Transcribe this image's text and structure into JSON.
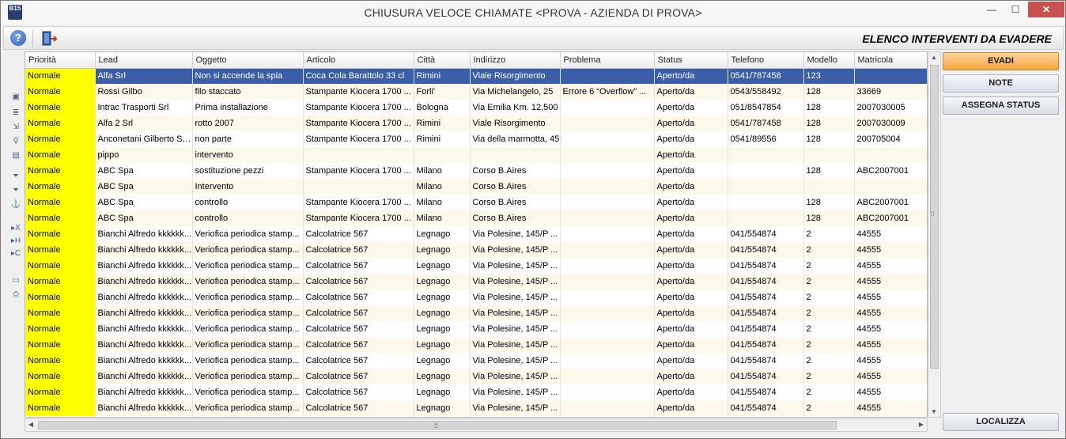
{
  "window": {
    "app_logo": "B15",
    "title": "CHIUSURA VELOCE CHIAMATE <PROVA - AZIENDA DI PROVA>",
    "minimize": "—",
    "maximize": "☐",
    "close": "✕"
  },
  "toolbar": {
    "help": "?",
    "title": "ELENCO INTERVENTI DA EVADERE"
  },
  "sidebar_icons": [
    "form-icon",
    "list-icon",
    "export-icon",
    "search-icon",
    "image-icon",
    "filter-icon",
    "filter-remove-icon",
    "anchor-icon",
    "x-icon",
    "h-icon",
    "c-icon",
    "monitor-icon",
    "print-icon"
  ],
  "grid": {
    "columns": [
      "Priorità",
      "Lead",
      "Oggetto",
      "Articolo",
      "Città",
      "Indirizzo",
      "Problema",
      "Status",
      "Telefono",
      "Modello",
      "Matricola"
    ],
    "rows": [
      [
        "Normale",
        "Alfa Srl",
        "Non si accende la spia",
        "Coca Cola Barattolo 33 cl",
        "Rimini",
        "Viale Risorgimento",
        "",
        "Aperto/da",
        "0541/787458",
        "123",
        ""
      ],
      [
        "Normale",
        "Rossi Gilbo",
        "filo staccato",
        "Stampante Kiocera 1700 ...",
        "Forli'",
        "Via Michelangelo, 25",
        "Errore 6 “Overflow” ...",
        "Aperto/da",
        "0543/558492",
        "128",
        "33669"
      ],
      [
        "Normale",
        "Intrac Trasporti Srl",
        "Prima installazione",
        "Stampante Kiocera 1700 ...",
        "Bologna",
        "Via Emilia Km. 12,500",
        "",
        "Aperto/da",
        "051/8547854",
        "128",
        "2007030005"
      ],
      [
        "Normale",
        "Alfa 2 Srl",
        "rotto 2007",
        "Stampante Kiocera 1700 ...",
        "Rimini",
        "Viale Risorgimento",
        "",
        "Aperto/da",
        "0541/787458",
        "128",
        "2007030009"
      ],
      [
        "Normale",
        "Anconetani Gilberto Spa",
        "non parte",
        "Stampante Kiocera 1700 ...",
        "Rimini",
        "Via della marmotta, 45",
        "",
        "Aperto/da",
        "0541/89556",
        "128",
        "200705004"
      ],
      [
        "Normale",
        "pippo",
        "intervento",
        "",
        "",
        "",
        "",
        "Aperto/da",
        "",
        "",
        ""
      ],
      [
        "Normale",
        "ABC Spa",
        "sostituzione pezzi",
        "Stampante Kiocera 1700 ...",
        "Milano",
        "Corso B.Aires",
        "",
        "Aperto/da",
        "",
        "128",
        "ABC2007001"
      ],
      [
        "Normale",
        "ABC Spa",
        "Intervento",
        "",
        "Milano",
        "Corso B.Aires",
        "",
        "Aperto/da",
        "",
        "",
        ""
      ],
      [
        "Normale",
        "ABC Spa",
        "controllo",
        "Stampante Kiocera 1700 ...",
        "Milano",
        "Corso B.Aires",
        "",
        "Aperto/da",
        "",
        "128",
        "ABC2007001"
      ],
      [
        "Normale",
        "ABC Spa",
        "controllo",
        "Stampante Kiocera 1700 ...",
        "Milano",
        "Corso B.Aires",
        "",
        "Aperto/da",
        "",
        "128",
        "ABC2007001"
      ],
      [
        "Normale",
        "Bianchi Alfredo kkkkkk...",
        "Veriofica periodica stamp...",
        "Calcolatrice 567",
        "Legnago",
        "Via Polesine, 145/P ...",
        "",
        "Aperto/da",
        "041/554874",
        "2",
        "44555"
      ],
      [
        "Normale",
        "Bianchi Alfredo kkkkkk...",
        "Veriofica periodica stamp...",
        "Calcolatrice 567",
        "Legnago",
        "Via Polesine, 145/P ...",
        "",
        "Aperto/da",
        "041/554874",
        "2",
        "44555"
      ],
      [
        "Normale",
        "Bianchi Alfredo kkkkkk...",
        "Veriofica periodica stamp...",
        "Calcolatrice 567",
        "Legnago",
        "Via Polesine, 145/P ...",
        "",
        "Aperto/da",
        "041/554874",
        "2",
        "44555"
      ],
      [
        "Normale",
        "Bianchi Alfredo kkkkkk...",
        "Veriofica periodica stamp...",
        "Calcolatrice 567",
        "Legnago",
        "Via Polesine, 145/P ...",
        "",
        "Aperto/da",
        "041/554874",
        "2",
        "44555"
      ],
      [
        "Normale",
        "Bianchi Alfredo kkkkkk...",
        "Veriofica periodica stamp...",
        "Calcolatrice 567",
        "Legnago",
        "Via Polesine, 145/P ...",
        "",
        "Aperto/da",
        "041/554874",
        "2",
        "44555"
      ],
      [
        "Normale",
        "Bianchi Alfredo kkkkkk...",
        "Veriofica periodica stamp...",
        "Calcolatrice 567",
        "Legnago",
        "Via Polesine, 145/P ...",
        "",
        "Aperto/da",
        "041/554874",
        "2",
        "44555"
      ],
      [
        "Normale",
        "Bianchi Alfredo kkkkkk...",
        "Veriofica periodica stamp...",
        "Calcolatrice 567",
        "Legnago",
        "Via Polesine, 145/P ...",
        "",
        "Aperto/da",
        "041/554874",
        "2",
        "44555"
      ],
      [
        "Normale",
        "Bianchi Alfredo kkkkkk...",
        "Veriofica periodica stamp...",
        "Calcolatrice 567",
        "Legnago",
        "Via Polesine, 145/P ...",
        "",
        "Aperto/da",
        "041/554874",
        "2",
        "44555"
      ],
      [
        "Normale",
        "Bianchi Alfredo kkkkkk...",
        "Veriofica periodica stamp...",
        "Calcolatrice 567",
        "Legnago",
        "Via Polesine, 145/P ...",
        "",
        "Aperto/da",
        "041/554874",
        "2",
        "44555"
      ],
      [
        "Normale",
        "Bianchi Alfredo kkkkkk...",
        "Veriofica periodica stamp...",
        "Calcolatrice 567",
        "Legnago",
        "Via Polesine, 145/P ...",
        "",
        "Aperto/da",
        "041/554874",
        "2",
        "44555"
      ],
      [
        "Normale",
        "Bianchi Alfredo kkkkkk...",
        "Veriofica periodica stamp...",
        "Calcolatrice 567",
        "Legnago",
        "Via Polesine, 145/P ...",
        "",
        "Aperto/da",
        "041/554874",
        "2",
        "44555"
      ],
      [
        "Normale",
        "Bianchi Alfredo kkkkkk...",
        "Veriofica periodica stamp...",
        "Calcolatrice 567",
        "Legnago",
        "Via Polesine, 145/P ...",
        "",
        "Aperto/da",
        "041/554874",
        "2",
        "44555"
      ]
    ],
    "selected_row": 0,
    "priority_color": "#ffff00",
    "selection_color": "#3b5ea9"
  },
  "actions": {
    "evadi": "EVADI",
    "note": "NOTE",
    "assegna_status": "ASSEGNA STATUS",
    "localizza": "LOCALIZZA"
  }
}
